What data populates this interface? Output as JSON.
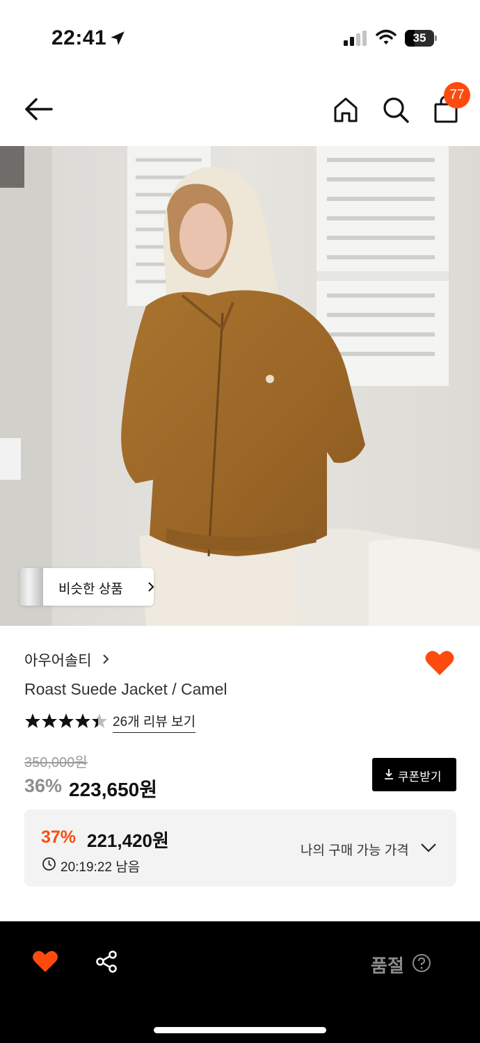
{
  "status_bar": {
    "time": "22:41",
    "battery": "35",
    "icons": [
      "location-arrow-icon",
      "signal-icon",
      "wifi-icon",
      "battery-icon"
    ]
  },
  "header": {
    "icons": [
      "back-arrow-icon",
      "home-icon",
      "search-icon",
      "shopping-bag-icon"
    ],
    "cart_count": "77"
  },
  "image": {
    "similar_button_label": "비슷한 상품"
  },
  "product": {
    "brand": "아우어솔티",
    "name": "Roast Suede Jacket / Camel",
    "rating": 4.5,
    "review_link": "26개 리뷰 보기",
    "original_price": "350,000원",
    "discount_rate": "36%",
    "sale_price": "223,650원",
    "coupon_button": "쿠폰받기"
  },
  "my_price": {
    "rate": "37%",
    "price": "221,420원",
    "remaining": "20:19:22 남음",
    "label": "나의 구매 가능 가격"
  },
  "bottom_bar": {
    "status_label": "품절"
  },
  "colors": {
    "accent": "#fd4b0f",
    "bottom_bar": "#000000",
    "info_box": "#f3f3f3"
  }
}
